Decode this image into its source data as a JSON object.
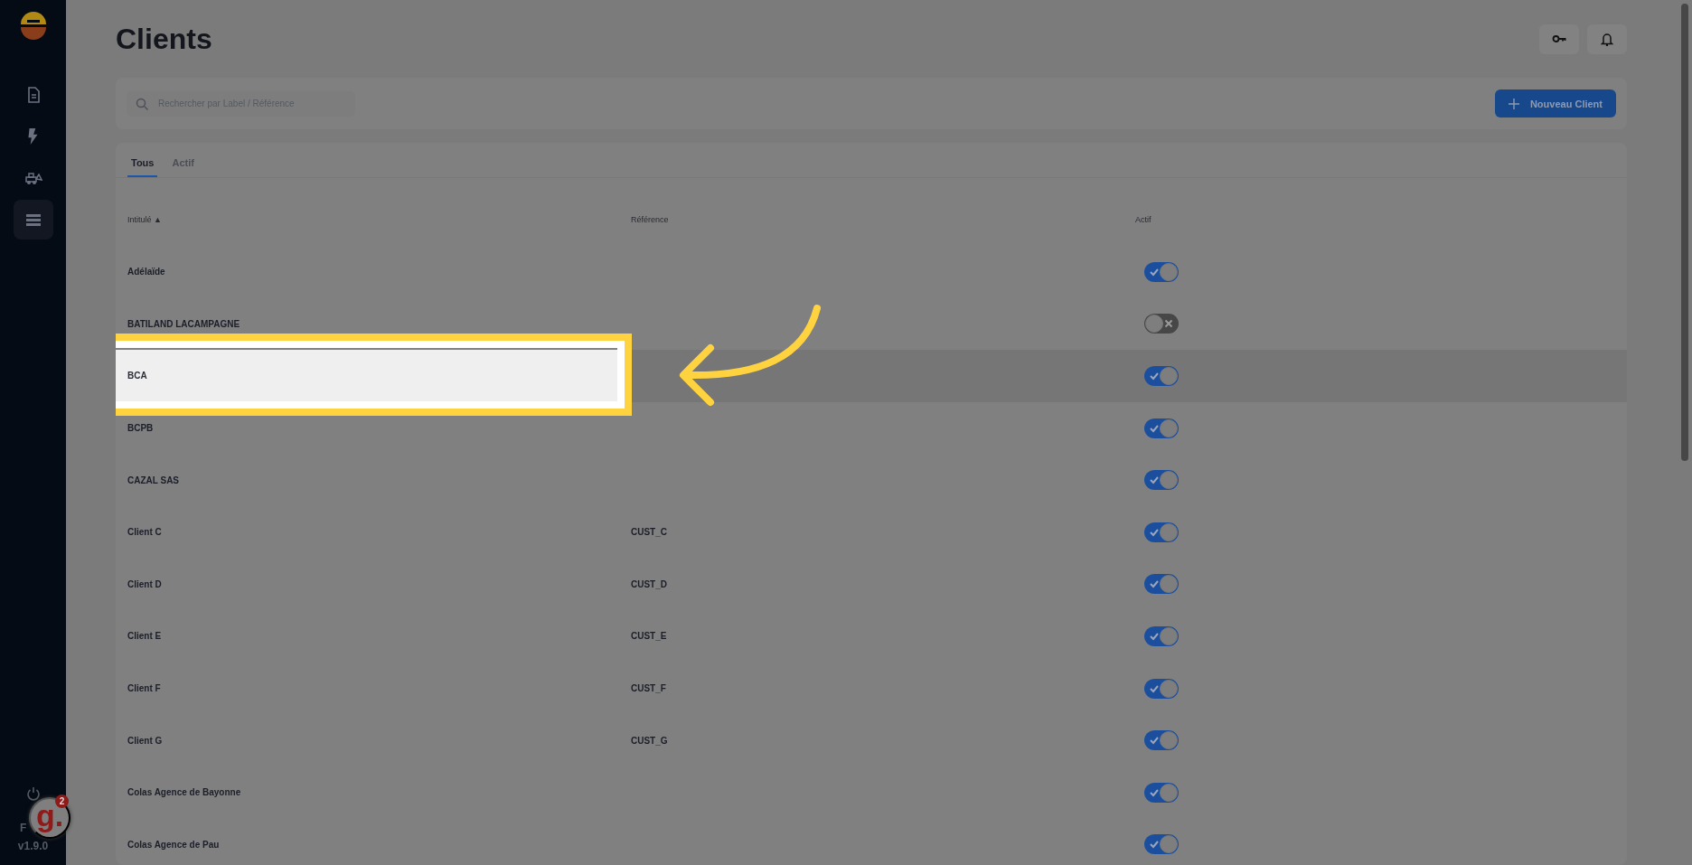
{
  "sidebar": {
    "items": [
      {
        "kind": "document",
        "selected": false
      },
      {
        "kind": "bolt",
        "selected": false
      },
      {
        "kind": "machine",
        "selected": false
      },
      {
        "kind": "list",
        "selected": true
      }
    ],
    "language": "F",
    "version": "v1.9.0"
  },
  "help_widget": {
    "logo": "g.",
    "count": "2"
  },
  "title": "Clients",
  "header_buttons": [
    {
      "kind": "key"
    },
    {
      "kind": "bell"
    }
  ],
  "search": {
    "placeholder": "Rechercher par Label / Référence"
  },
  "new_button": {
    "label": "Nouveau Client"
  },
  "tabs": [
    {
      "label": "Tous",
      "selected": true
    },
    {
      "label": "Actif",
      "selected": false
    }
  ],
  "table": {
    "columns": [
      "Intitulé ▲",
      "Référence",
      "Actif"
    ],
    "rows": [
      {
        "name": "Adélaïde",
        "reference": "",
        "active": true,
        "highlighted": false
      },
      {
        "name": "BATILAND LACAMPAGNE",
        "reference": "",
        "active": false,
        "highlighted": false
      },
      {
        "name": "BCA",
        "reference": "",
        "active": true,
        "highlighted": true
      },
      {
        "name": "BCPB",
        "reference": "",
        "active": true,
        "highlighted": false
      },
      {
        "name": "CAZAL SAS",
        "reference": "",
        "active": true,
        "highlighted": false
      },
      {
        "name": "Client C",
        "reference": "CUST_C",
        "active": true,
        "highlighted": false
      },
      {
        "name": "Client D",
        "reference": "CUST_D",
        "active": true,
        "highlighted": false
      },
      {
        "name": "Client E",
        "reference": "CUST_E",
        "active": true,
        "highlighted": false
      },
      {
        "name": "Client F",
        "reference": "CUST_F",
        "active": true,
        "highlighted": false
      },
      {
        "name": "Client G",
        "reference": "CUST_G",
        "active": true,
        "highlighted": false
      },
      {
        "name": "Colas Agence de Bayonne",
        "reference": "",
        "active": true,
        "highlighted": false
      },
      {
        "name": "Colas Agence de Pau",
        "reference": "",
        "active": true,
        "highlighted": false
      }
    ]
  }
}
